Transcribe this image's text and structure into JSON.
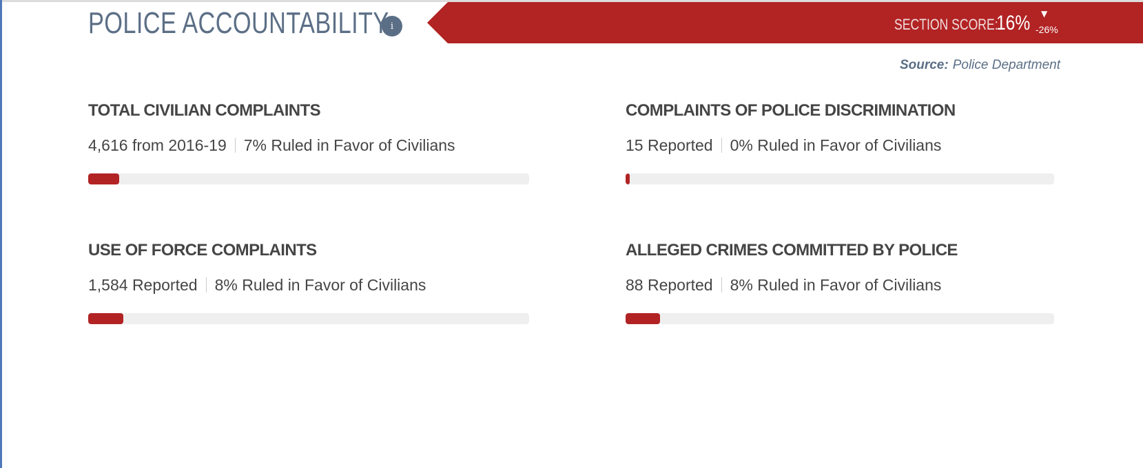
{
  "header": {
    "title": "POLICE ACCOUNTABILITY",
    "info_icon": "info-icon",
    "score_label": "SECTION SCORE:",
    "score_value": "16%",
    "score_trend_icon": "triangle-down-icon",
    "score_change": "-26%"
  },
  "source": {
    "label": "Source:",
    "name": "Police Department"
  },
  "metrics": [
    {
      "title": "TOTAL CIVILIAN COMPLAINTS",
      "count": "4,616 from 2016-19",
      "ruling": "7% Ruled in Favor of Civilians",
      "favor_fraction": 0.07
    },
    {
      "title": "COMPLAINTS OF POLICE DISCRIMINATION",
      "count": "15 Reported",
      "ruling": "0% Ruled in Favor of Civilians",
      "favor_fraction": 0.0
    },
    {
      "title": "USE OF FORCE COMPLAINTS",
      "count": "1,584 Reported",
      "ruling": "8% Ruled in Favor of Civilians",
      "favor_fraction": 0.08
    },
    {
      "title": "ALLEGED CRIMES COMMITTED BY POLICE",
      "count": "88 Reported",
      "ruling": "8% Ruled in Favor of Civilians",
      "favor_fraction": 0.08
    }
  ],
  "colors": {
    "accent": "#b22324",
    "heading_text": "#5c6f86",
    "body_text": "#454545",
    "track": "#efefef"
  }
}
